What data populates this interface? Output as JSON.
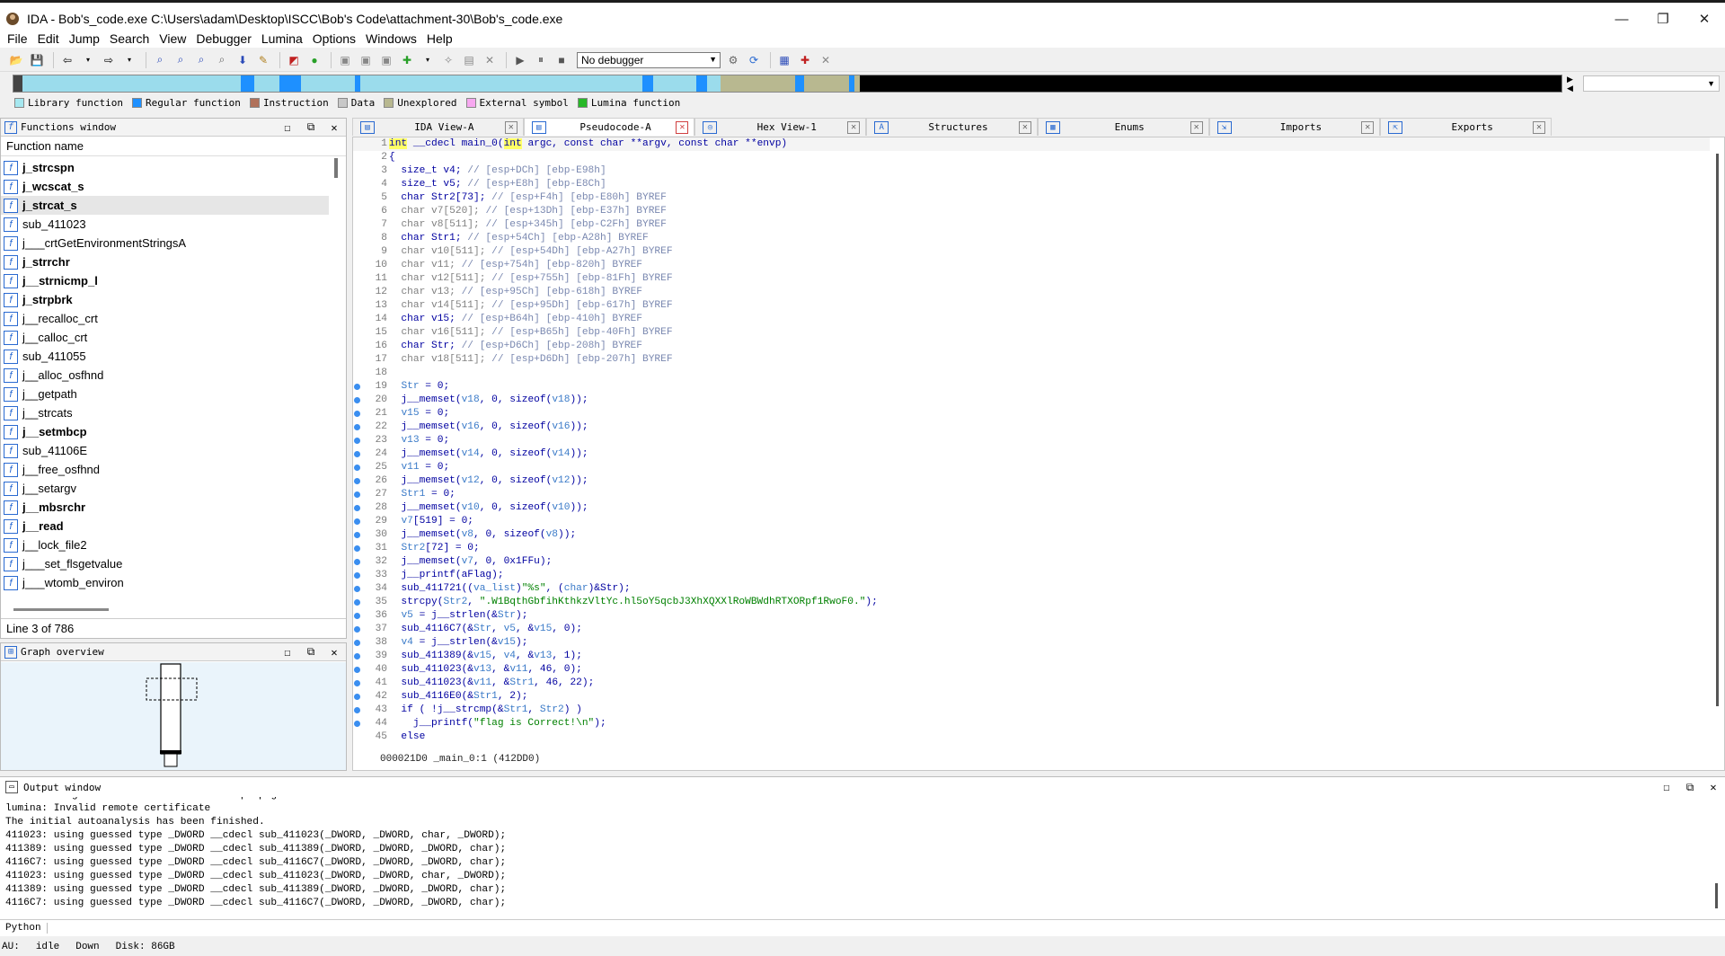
{
  "window": {
    "title": "IDA - Bob's_code.exe C:\\Users\\adam\\Desktop\\ISCC\\Bob's Code\\attachment-30\\Bob's_code.exe",
    "controls": [
      "minimize",
      "maximize",
      "close"
    ]
  },
  "menu": [
    "File",
    "Edit",
    "Jump",
    "Search",
    "View",
    "Debugger",
    "Lumina",
    "Options",
    "Windows",
    "Help"
  ],
  "toolbar": {
    "debugger_select": "No debugger"
  },
  "legend": [
    {
      "label": "Library function",
      "color": "#a6e8f0"
    },
    {
      "label": "Regular function",
      "color": "#1e90ff"
    },
    {
      "label": "Instruction",
      "color": "#b0715a"
    },
    {
      "label": "Data",
      "color": "#c8c8c8"
    },
    {
      "label": "Unexplored",
      "color": "#b8b890"
    },
    {
      "label": "External symbol",
      "color": "#f7a8f0"
    },
    {
      "label": "Lumina function",
      "color": "#28b828"
    }
  ],
  "functions_window": {
    "title": "Functions window",
    "column": "Function name",
    "items": [
      {
        "name": "j_strcspn",
        "bold": true
      },
      {
        "name": "j_wcscat_s",
        "bold": true
      },
      {
        "name": "j_strcat_s",
        "bold": true
      },
      {
        "name": "sub_411023",
        "bold": false
      },
      {
        "name": "j___crtGetEnvironmentStringsA",
        "bold": false
      },
      {
        "name": "j_strrchr",
        "bold": true
      },
      {
        "name": "j__strnicmp_l",
        "bold": true
      },
      {
        "name": "j_strpbrk",
        "bold": true
      },
      {
        "name": "j__recalloc_crt",
        "bold": false
      },
      {
        "name": "j__calloc_crt",
        "bold": false
      },
      {
        "name": "sub_411055",
        "bold": false
      },
      {
        "name": "j__alloc_osfhnd",
        "bold": false
      },
      {
        "name": "j__getpath",
        "bold": false
      },
      {
        "name": "j__strcats",
        "bold": false
      },
      {
        "name": "j__setmbcp",
        "bold": true
      },
      {
        "name": "sub_41106E",
        "bold": false
      },
      {
        "name": "j__free_osfhnd",
        "bold": false
      },
      {
        "name": "j__setargv",
        "bold": false
      },
      {
        "name": "j__mbsrchr",
        "bold": true
      },
      {
        "name": "j__read",
        "bold": true
      },
      {
        "name": "j__lock_file2",
        "bold": false
      },
      {
        "name": "j___set_flsgetvalue",
        "bold": false
      },
      {
        "name": "j___wtomb_environ",
        "bold": false
      }
    ],
    "status": "Line 3 of 786"
  },
  "graph_overview": {
    "title": "Graph overview"
  },
  "tabs": [
    {
      "label": "IDA View-A",
      "icon": "ida-view-icon",
      "glyph": "▤"
    },
    {
      "label": "Pseudocode-A",
      "icon": "pseudocode-icon",
      "glyph": "▤",
      "active": true
    },
    {
      "label": "Hex View-1",
      "icon": "hex-view-icon",
      "glyph": "◎"
    },
    {
      "label": "Structures",
      "icon": "structures-icon",
      "glyph": "A"
    },
    {
      "label": "Enums",
      "icon": "enums-icon",
      "glyph": "▦"
    },
    {
      "label": "Imports",
      "icon": "imports-icon",
      "glyph": "⇲"
    },
    {
      "label": "Exports",
      "icon": "exports-icon",
      "glyph": "⇱"
    }
  ],
  "pseudocode": {
    "lines": [
      {
        "n": "1",
        "dot": false,
        "html": "<span class=\"kw-hl\">int</span> __cdecl main_0(<span class=\"kw-hl\">int</span> argc, const char **argv, const char **envp)"
      },
      {
        "n": "2",
        "dot": false,
        "html": "{"
      },
      {
        "n": "3",
        "dot": false,
        "html": "  size_t v4; <span class=\"c\">// [esp+DCh] [ebp-E98h]</span>"
      },
      {
        "n": "4",
        "dot": false,
        "html": "  size_t v5; <span class=\"c\">// [esp+E8h] [ebp-E8Ch]</span>"
      },
      {
        "n": "5",
        "dot": false,
        "html": "  char Str2[73]; <span class=\"c\">// [esp+F4h] [ebp-E80h] BYREF</span>"
      },
      {
        "n": "6",
        "dot": false,
        "html": "  <span class=\"g\">char v7[520];</span> <span class=\"c\">// [esp+13Dh] [ebp-E37h] BYREF</span>"
      },
      {
        "n": "7",
        "dot": false,
        "html": "  <span class=\"g\">char v8[511];</span> <span class=\"c\">// [esp+345h] [ebp-C2Fh] BYREF</span>"
      },
      {
        "n": "8",
        "dot": false,
        "html": "  char Str1; <span class=\"c\">// [esp+54Ch] [ebp-A28h] BYREF</span>"
      },
      {
        "n": "9",
        "dot": false,
        "html": "  <span class=\"g\">char v10[511];</span> <span class=\"c\">// [esp+54Dh] [ebp-A27h] BYREF</span>"
      },
      {
        "n": "10",
        "dot": false,
        "html": "  <span class=\"g\">char v11;</span> <span class=\"c\">// [esp+754h] [ebp-820h] BYREF</span>"
      },
      {
        "n": "11",
        "dot": false,
        "html": "  <span class=\"g\">char v12[511];</span> <span class=\"c\">// [esp+755h] [ebp-81Fh] BYREF</span>"
      },
      {
        "n": "12",
        "dot": false,
        "html": "  <span class=\"g\">char v13;</span> <span class=\"c\">// [esp+95Ch] [ebp-618h] BYREF</span>"
      },
      {
        "n": "13",
        "dot": false,
        "html": "  <span class=\"g\">char v14[511];</span> <span class=\"c\">// [esp+95Dh] [ebp-617h] BYREF</span>"
      },
      {
        "n": "14",
        "dot": false,
        "html": "  char v15; <span class=\"c\">// [esp+B64h] [ebp-410h] BYREF</span>"
      },
      {
        "n": "15",
        "dot": false,
        "html": "  <span class=\"g\">char v16[511];</span> <span class=\"c\">// [esp+B65h] [ebp-40Fh] BYREF</span>"
      },
      {
        "n": "16",
        "dot": false,
        "html": "  char Str; <span class=\"c\">// [esp+D6Ch] [ebp-208h] BYREF</span>"
      },
      {
        "n": "17",
        "dot": false,
        "html": "  <span class=\"g\">char v18[511];</span> <span class=\"c\">// [esp+D6Dh] [ebp-207h] BYREF</span>"
      },
      {
        "n": "18",
        "dot": false,
        "html": ""
      },
      {
        "n": "19",
        "dot": true,
        "html": "  <span class=\"gv\">Str</span> = 0;"
      },
      {
        "n": "20",
        "dot": true,
        "html": "  j__memset(<span class=\"gv\">v18</span>, 0, sizeof(<span class=\"gv\">v18</span>));"
      },
      {
        "n": "21",
        "dot": true,
        "html": "  <span class=\"gv\">v15</span> = 0;"
      },
      {
        "n": "22",
        "dot": true,
        "html": "  j__memset(<span class=\"gv\">v16</span>, 0, sizeof(<span class=\"gv\">v16</span>));"
      },
      {
        "n": "23",
        "dot": true,
        "html": "  <span class=\"gv\">v13</span> = 0;"
      },
      {
        "n": "24",
        "dot": true,
        "html": "  j__memset(<span class=\"gv\">v14</span>, 0, sizeof(<span class=\"gv\">v14</span>));"
      },
      {
        "n": "25",
        "dot": true,
        "html": "  <span class=\"gv\">v11</span> = 0;"
      },
      {
        "n": "26",
        "dot": true,
        "html": "  j__memset(<span class=\"gv\">v12</span>, 0, sizeof(<span class=\"gv\">v12</span>));"
      },
      {
        "n": "27",
        "dot": true,
        "html": "  <span class=\"gv\">Str1</span> = 0;"
      },
      {
        "n": "28",
        "dot": true,
        "html": "  j__memset(<span class=\"gv\">v10</span>, 0, sizeof(<span class=\"gv\">v10</span>));"
      },
      {
        "n": "29",
        "dot": true,
        "html": "  <span class=\"gv\">v7</span>[519] = 0;"
      },
      {
        "n": "30",
        "dot": true,
        "html": "  j__memset(<span class=\"gv\">v8</span>, 0, sizeof(<span class=\"gv\">v8</span>));"
      },
      {
        "n": "31",
        "dot": true,
        "html": "  <span class=\"gv\">Str2</span>[72] = 0;"
      },
      {
        "n": "32",
        "dot": true,
        "html": "  j__memset(<span class=\"gv\">v7</span>, 0, 0x1FFu);"
      },
      {
        "n": "33",
        "dot": true,
        "html": "  j__printf(aFlag);"
      },
      {
        "n": "34",
        "dot": true,
        "html": "  sub_411721((<span class=\"gv\">va_list</span>)<span class=\"str\">\"%s\"</span>, (<span class=\"gv\">char</span>)&amp;Str);"
      },
      {
        "n": "35",
        "dot": true,
        "html": "  strcpy(<span class=\"gv\">Str2</span>, <span class=\"str\">\".W1BqthGbfihKthkzVltYc.hl5oY5qcbJ3XhXQXXlRoWBWdhRTXORpf1RwoF0.\"</span>);"
      },
      {
        "n": "36",
        "dot": true,
        "html": "  <span class=\"gv\">v5</span> = j__strlen(&amp;<span class=\"gv\">Str</span>);"
      },
      {
        "n": "37",
        "dot": true,
        "html": "  sub_4116C7(&amp;<span class=\"gv\">Str</span>, <span class=\"gv\">v5</span>, &amp;<span class=\"gv\">v15</span>, 0);"
      },
      {
        "n": "38",
        "dot": true,
        "html": "  <span class=\"gv\">v4</span> = j__strlen(&amp;<span class=\"gv\">v15</span>);"
      },
      {
        "n": "39",
        "dot": true,
        "html": "  sub_411389(&amp;<span class=\"gv\">v15</span>, <span class=\"gv\">v4</span>, &amp;<span class=\"gv\">v13</span>, 1);"
      },
      {
        "n": "40",
        "dot": true,
        "html": "  sub_411023(&amp;<span class=\"gv\">v13</span>, &amp;<span class=\"gv\">v11</span>, 46, 0);"
      },
      {
        "n": "41",
        "dot": true,
        "html": "  sub_411023(&amp;<span class=\"gv\">v11</span>, &amp;<span class=\"gv\">Str1</span>, 46, 22);"
      },
      {
        "n": "42",
        "dot": true,
        "html": "  sub_4116E0(&amp;<span class=\"gv\">Str1</span>, 2);"
      },
      {
        "n": "43",
        "dot": true,
        "html": "  if ( !j__strcmp(&amp;<span class=\"gv\">Str1</span>, <span class=\"gv\">Str2</span>) )"
      },
      {
        "n": "44",
        "dot": true,
        "html": "    j__printf(<span class=\"str\">\"flag is Correct!\\n\"</span>);"
      },
      {
        "n": "45",
        "dot": false,
        "html": "  else"
      }
    ],
    "status": "000021D0 _main_0:1 (412DD0)"
  },
  "output_window": {
    "title": "Output window",
    "lines": [
      "Function argument information has been propagated",
      "lumina: Invalid remote certificate",
      "The initial autoanalysis has been finished.",
      "411023: using guessed type _DWORD __cdecl sub_411023(_DWORD, _DWORD, char, _DWORD);",
      "411389: using guessed type _DWORD __cdecl sub_411389(_DWORD, _DWORD, _DWORD, char);",
      "4116C7: using guessed type _DWORD __cdecl sub_4116C7(_DWORD, _DWORD, _DWORD, char);",
      "411023: using guessed type _DWORD __cdecl sub_411023(_DWORD, _DWORD, char, _DWORD);",
      "411389: using guessed type _DWORD __cdecl sub_411389(_DWORD, _DWORD, _DWORD, char);",
      "4116C7: using guessed type _DWORD __cdecl sub_4116C7(_DWORD, _DWORD, _DWORD, char);"
    ],
    "python_label": "Python"
  },
  "statusbar": {
    "au": "AU:",
    "state": "idle",
    "direction": "Down",
    "disk": "Disk: 86GB"
  }
}
